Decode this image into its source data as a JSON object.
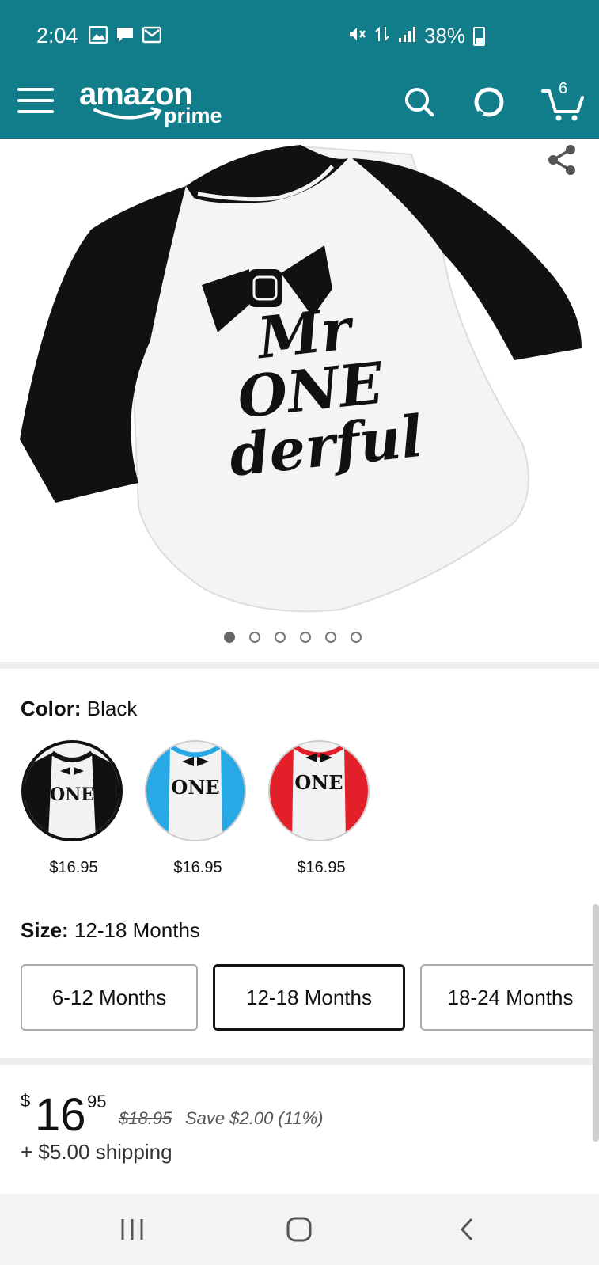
{
  "status_bar": {
    "time": "2:04",
    "battery": "38%",
    "icons": [
      "image-icon",
      "message-icon",
      "mail-icon",
      "mute-icon",
      "network-icon",
      "signal-icon",
      "battery-icon"
    ]
  },
  "header": {
    "logo_word": "amazon",
    "logo_sub": "prime",
    "cart_count": "6",
    "color": "#127d8a"
  },
  "product": {
    "image_caption": "Mr ONE derful",
    "dot_count": 6,
    "active_dot": 0
  },
  "color_section": {
    "label": "Color:",
    "value": "Black",
    "options": [
      {
        "name": "Black",
        "price": "$16.95",
        "sleeve": "#111111"
      },
      {
        "name": "Blue",
        "price": "$16.95",
        "sleeve": "#29a8e6"
      },
      {
        "name": "Red",
        "price": "$16.95",
        "sleeve": "#e3202a"
      }
    ]
  },
  "size_section": {
    "label": "Size:",
    "value": "12-18 Months",
    "options": [
      "6-12 Months",
      "12-18 Months",
      "18-24 Months"
    ]
  },
  "price": {
    "currency": "$",
    "dollars": "16",
    "cents": "95",
    "list_price": "$18.95",
    "savings": "Save $2.00 (11%)",
    "shipping": "+ $5.00 shipping"
  }
}
